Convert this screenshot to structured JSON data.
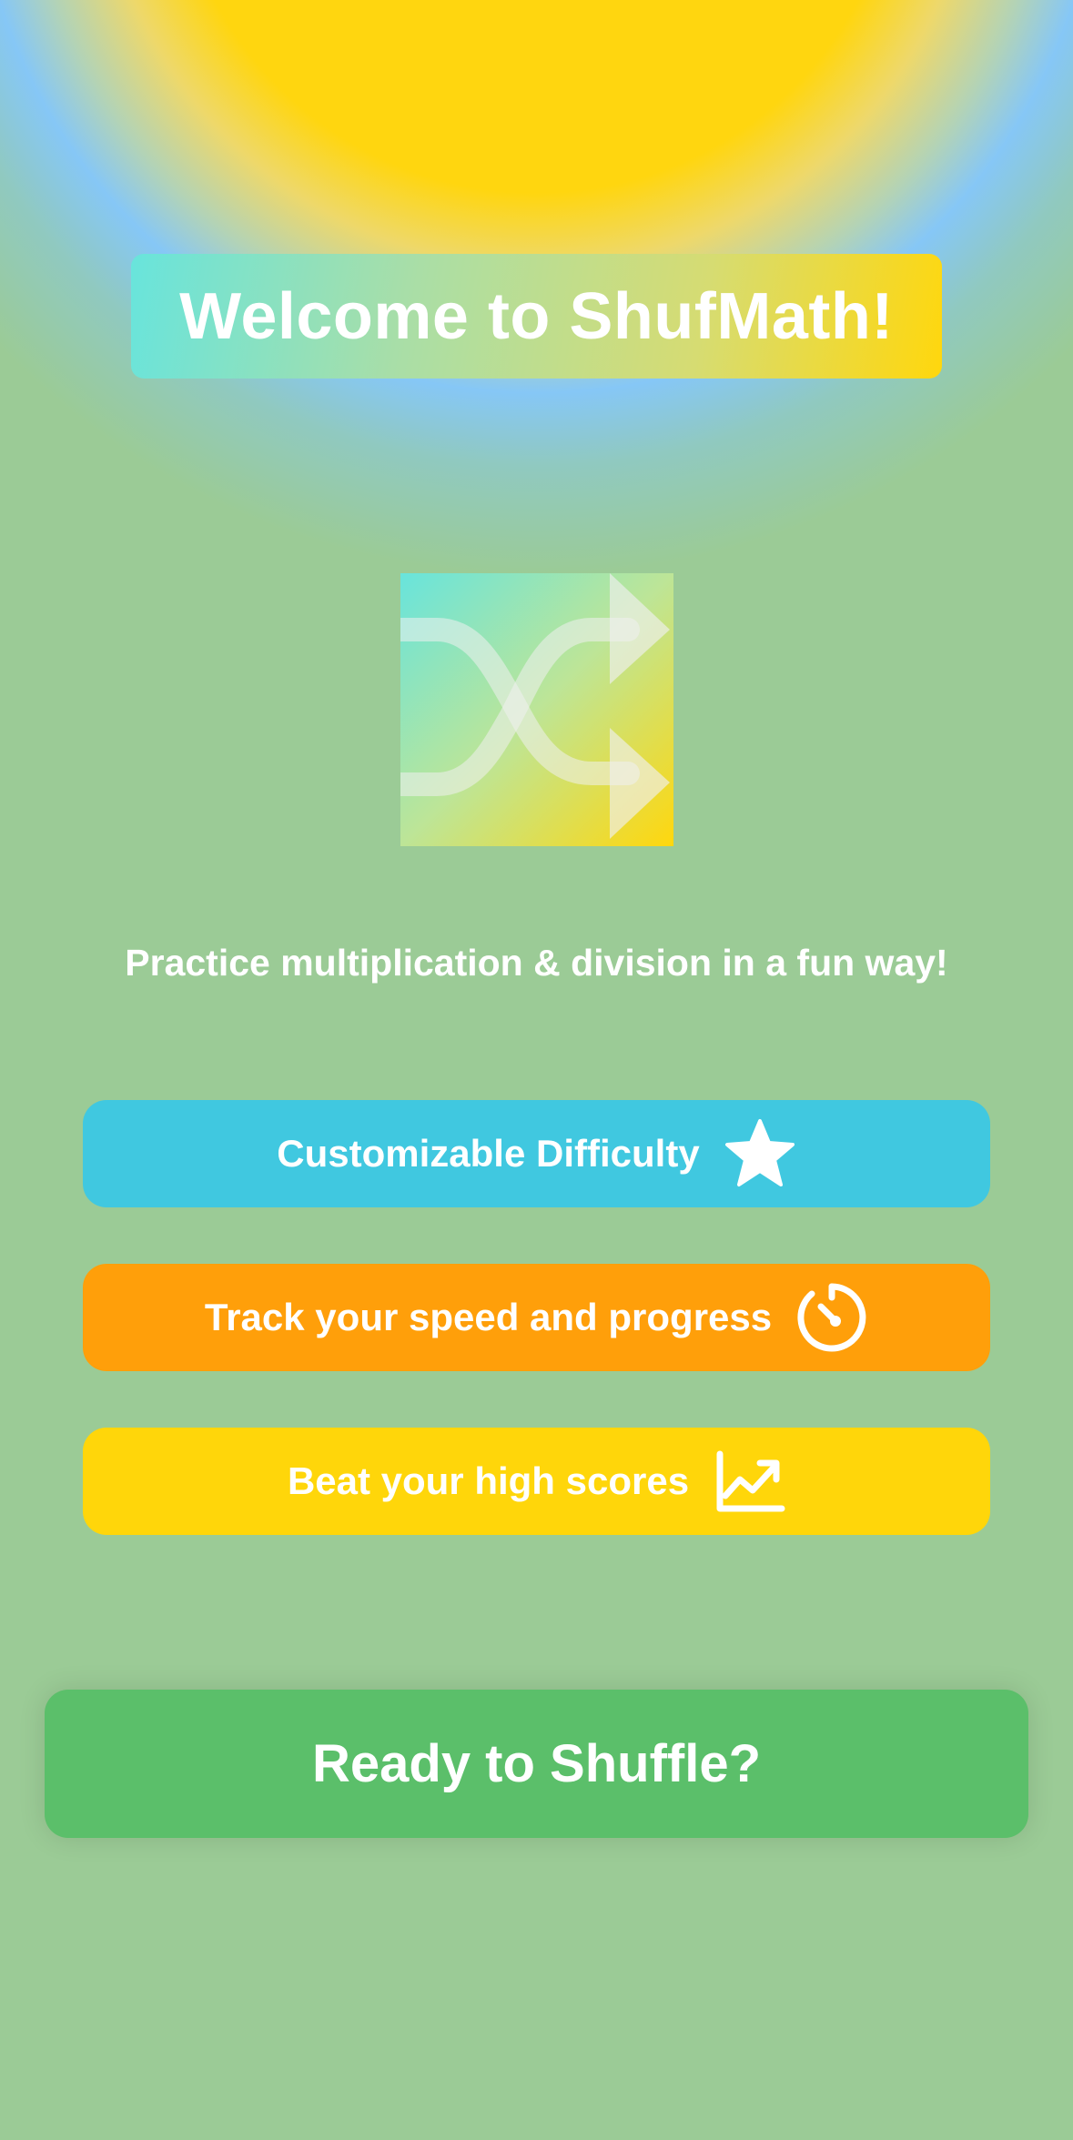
{
  "header": {
    "title": "Welcome to ShufMath!"
  },
  "logo": {
    "icon": "shuffle-icon"
  },
  "tagline": "Practice multiplication & division in a fun way!",
  "features": [
    {
      "label": "Customizable Difficulty",
      "icon": "star-icon",
      "color": "#40c8e0"
    },
    {
      "label": "Track your speed and progress",
      "icon": "timer-icon",
      "color": "#ff9f0a"
    },
    {
      "label": "Beat your high scores",
      "icon": "chart-line-uptrend-icon",
      "color": "#ffd60a"
    }
  ],
  "cta": {
    "label": "Ready to Shuffle?",
    "color": "#5bbf6a"
  }
}
